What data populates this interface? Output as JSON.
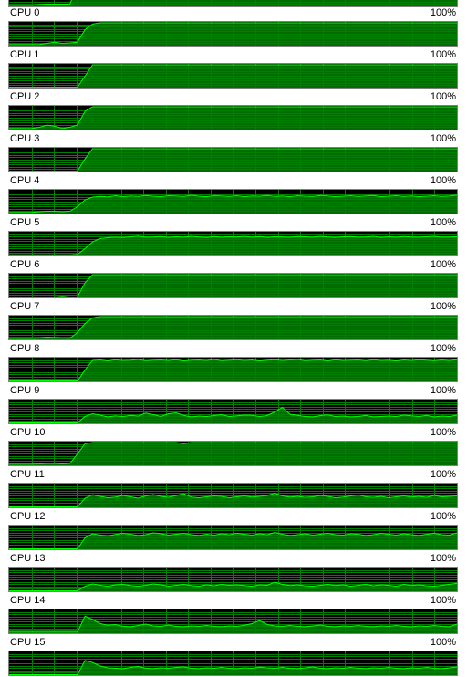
{
  "colors": {
    "graph_background": "#000000",
    "grid_line": "#008000",
    "usage_fill": "#008000",
    "usage_line": "#00ff00",
    "border": "#808080"
  },
  "cores": [
    {
      "label": "CPU 0",
      "max": "100%",
      "usage": [
        0.05,
        0.05,
        0.05,
        0.05,
        0.08,
        0.1,
        0.1,
        0.1,
        0.1,
        0.95,
        1,
        1,
        1,
        1,
        1,
        1,
        1,
        1,
        1,
        1,
        1,
        1,
        1,
        1,
        1,
        1,
        1,
        1,
        1,
        1,
        1,
        1,
        1,
        1,
        1,
        1,
        1,
        1,
        1,
        1,
        1,
        1,
        1,
        1,
        1,
        1,
        1,
        1,
        1,
        1,
        1,
        1,
        1,
        1,
        1,
        1,
        1,
        1,
        1,
        1
      ]
    },
    {
      "label": "CPU 1",
      "max": "100%",
      "usage": [
        0.05,
        0.05,
        0.05,
        0.05,
        0.05,
        0.1,
        0.15,
        0.1,
        0.12,
        0.15,
        0.7,
        0.95,
        1,
        1,
        1,
        1,
        1,
        1,
        1,
        1,
        1,
        1,
        1,
        1,
        1,
        1,
        1,
        1,
        1,
        1,
        1,
        1,
        1,
        1,
        1,
        1,
        1,
        1,
        1,
        1,
        1,
        1,
        1,
        1,
        1,
        1,
        1,
        1,
        1,
        1,
        1,
        1,
        1,
        1,
        1,
        1,
        1,
        1,
        1,
        1
      ]
    },
    {
      "label": "CPU 2",
      "max": "100%",
      "usage": [
        0.02,
        0.02,
        0.02,
        0.02,
        0.02,
        0.02,
        0.02,
        0.02,
        0.02,
        0.02,
        0.5,
        1,
        1,
        1,
        1,
        1,
        1,
        1,
        1,
        1,
        1,
        1,
        1,
        1,
        1,
        1,
        1,
        1,
        1,
        1,
        1,
        1,
        1,
        1,
        1,
        1,
        1,
        1,
        1,
        1,
        1,
        1,
        1,
        1,
        1,
        1,
        1,
        1,
        1,
        1,
        1,
        1,
        1,
        1,
        1,
        1,
        1,
        1,
        1,
        1
      ]
    },
    {
      "label": "CPU 3",
      "max": "100%",
      "usage": [
        0.05,
        0.05,
        0.05,
        0.05,
        0.1,
        0.2,
        0.15,
        0.05,
        0.1,
        0.2,
        0.8,
        1,
        1,
        1,
        1,
        1,
        1,
        1,
        1,
        1,
        1,
        1,
        1,
        1,
        1,
        1,
        1,
        1,
        1,
        1,
        1,
        1,
        1,
        1,
        1,
        1,
        1,
        1,
        1,
        1,
        1,
        1,
        1,
        1,
        1,
        1,
        1,
        1,
        1,
        1,
        1,
        1,
        1,
        1,
        1,
        1,
        1,
        1,
        1,
        1
      ]
    },
    {
      "label": "CPU 4",
      "max": "100%",
      "usage": [
        0.02,
        0.02,
        0.02,
        0.02,
        0.02,
        0.02,
        0.02,
        0.02,
        0.02,
        0.02,
        0.55,
        1,
        1,
        1,
        1,
        1,
        1,
        1,
        1,
        1,
        1,
        1,
        1,
        1,
        1,
        1,
        1,
        1,
        1,
        1,
        1,
        1,
        1,
        1,
        1,
        1,
        1,
        1,
        1,
        1,
        1,
        1,
        1,
        1,
        1,
        1,
        1,
        1,
        1,
        1,
        1,
        1,
        1,
        1,
        1,
        1,
        1,
        1,
        1,
        1
      ]
    },
    {
      "label": "CPU 5",
      "max": "100%",
      "usage": [
        0.05,
        0.05,
        0.05,
        0.05,
        0.08,
        0.1,
        0.1,
        0.08,
        0.1,
        0.3,
        0.6,
        0.72,
        0.75,
        0.73,
        0.78,
        0.74,
        0.77,
        0.75,
        0.79,
        0.76,
        0.74,
        0.78,
        0.77,
        0.75,
        0.8,
        0.76,
        0.74,
        0.78,
        0.77,
        0.75,
        0.78,
        0.74,
        0.77,
        0.76,
        0.79,
        0.75,
        0.77,
        0.74,
        0.78,
        0.76,
        0.75,
        0.79,
        0.77,
        0.74,
        0.76,
        0.78,
        0.75,
        0.77,
        0.79,
        0.74,
        0.76,
        0.78,
        0.75,
        0.77,
        0.74,
        0.76,
        0.78,
        0.75,
        0.77,
        0.8
      ]
    },
    {
      "label": "CPU 6",
      "max": "100%",
      "usage": [
        0.03,
        0.03,
        0.03,
        0.03,
        0.03,
        0.03,
        0.03,
        0.03,
        0.03,
        0.05,
        0.3,
        0.6,
        0.75,
        0.78,
        0.8,
        0.79,
        0.82,
        0.85,
        0.8,
        0.81,
        0.83,
        0.79,
        0.82,
        0.8,
        0.84,
        0.81,
        0.79,
        0.83,
        0.8,
        0.82,
        0.81,
        0.84,
        0.8,
        0.83,
        0.79,
        0.82,
        0.81,
        0.8,
        0.83,
        0.82,
        0.8,
        0.84,
        0.81,
        0.79,
        0.82,
        0.83,
        0.8,
        0.81,
        0.84,
        0.79,
        0.82,
        0.8,
        0.83,
        0.81,
        0.8,
        0.82,
        0.84,
        0.8,
        0.81,
        0.82
      ]
    },
    {
      "label": "CPU 7",
      "max": "100%",
      "usage": [
        0.02,
        0.02,
        0.02,
        0.02,
        0.02,
        0.02,
        0.02,
        0.05,
        0.02,
        0.02,
        0.65,
        1,
        1,
        1,
        1,
        1,
        1,
        1,
        1,
        1,
        1,
        1,
        1,
        1,
        1,
        1,
        1,
        1,
        1,
        1,
        1,
        1,
        1,
        1,
        1,
        1,
        1,
        1,
        1,
        1,
        1,
        1,
        1,
        1,
        1,
        1,
        1,
        1,
        1,
        1,
        1,
        1,
        1,
        1,
        1,
        1,
        1,
        1,
        1,
        1
      ]
    },
    {
      "label": "CPU 8",
      "max": "100%",
      "usage": [
        0.05,
        0.05,
        0.05,
        0.05,
        0.06,
        0.1,
        0.08,
        0.06,
        0.05,
        0.3,
        0.7,
        0.95,
        1,
        1,
        1,
        1,
        1,
        1,
        1,
        1,
        1,
        1,
        1,
        1,
        1,
        1,
        1,
        1,
        1,
        1,
        1,
        1,
        1,
        1,
        1,
        1,
        1,
        1,
        1,
        1,
        1,
        1,
        1,
        1,
        1,
        1,
        1,
        1,
        1,
        1,
        1,
        1,
        1,
        1,
        1,
        1,
        1,
        1,
        1,
        1
      ]
    },
    {
      "label": "CPU 9",
      "max": "100%",
      "usage": [
        0.02,
        0.02,
        0.02,
        0.02,
        0.02,
        0.02,
        0.02,
        0.02,
        0.02,
        0.02,
        0.5,
        0.92,
        0.94,
        0.9,
        0.95,
        0.92,
        0.93,
        0.96,
        0.91,
        0.93,
        0.94,
        0.92,
        0.95,
        0.9,
        0.93,
        0.94,
        0.92,
        0.96,
        0.91,
        0.93,
        0.95,
        0.92,
        0.94,
        0.9,
        0.93,
        0.95,
        0.92,
        0.94,
        0.96,
        0.91,
        0.93,
        0.94,
        0.9,
        0.95,
        0.92,
        0.93,
        0.94,
        0.91,
        0.95,
        0.92,
        0.93,
        0.9,
        0.94,
        0.92,
        0.95,
        0.93,
        0.91,
        0.94,
        0.92,
        0.95
      ]
    },
    {
      "label": "CPU 10",
      "max": "100%",
      "usage": [
        0.02,
        0.02,
        0.02,
        0.02,
        0.02,
        0.02,
        0.02,
        0.02,
        0.02,
        0.02,
        0.3,
        0.42,
        0.36,
        0.28,
        0.33,
        0.3,
        0.35,
        0.32,
        0.45,
        0.38,
        0.3,
        0.42,
        0.46,
        0.35,
        0.28,
        0.32,
        0.3,
        0.34,
        0.38,
        0.3,
        0.33,
        0.36,
        0.35,
        0.3,
        0.34,
        0.5,
        0.7,
        0.4,
        0.35,
        0.3,
        0.28,
        0.34,
        0.37,
        0.3,
        0.32,
        0.28,
        0.3,
        0.35,
        0.28,
        0.3,
        0.32,
        0.3,
        0.36,
        0.33,
        0.3,
        0.35,
        0.28,
        0.32,
        0.3,
        0.36
      ]
    },
    {
      "label": "CPU 11",
      "max": "100%",
      "usage": [
        0.05,
        0.05,
        0.05,
        0.05,
        0.06,
        0.08,
        0.08,
        0.06,
        0.08,
        0.5,
        0.95,
        1,
        1,
        1,
        1,
        1,
        1,
        1,
        1,
        1,
        1,
        1,
        1,
        0.95,
        1,
        1,
        1,
        1,
        1,
        1,
        1,
        1,
        1,
        1,
        1,
        1,
        1,
        1,
        1,
        1,
        1,
        1,
        1,
        1,
        1,
        1,
        1,
        1,
        1,
        1,
        1,
        1,
        1,
        1,
        1,
        1,
        1,
        1,
        1,
        1
      ]
    },
    {
      "label": "CPU 12",
      "max": "100%",
      "usage": [
        0.02,
        0.02,
        0.02,
        0.02,
        0.02,
        0.02,
        0.02,
        0.02,
        0.02,
        0.02,
        0.4,
        0.55,
        0.48,
        0.42,
        0.45,
        0.52,
        0.46,
        0.4,
        0.5,
        0.56,
        0.48,
        0.44,
        0.52,
        0.6,
        0.45,
        0.42,
        0.46,
        0.5,
        0.48,
        0.42,
        0.46,
        0.5,
        0.45,
        0.48,
        0.52,
        0.62,
        0.5,
        0.45,
        0.48,
        0.44,
        0.46,
        0.52,
        0.48,
        0.42,
        0.45,
        0.5,
        0.55,
        0.46,
        0.44,
        0.48,
        0.42,
        0.46,
        0.5,
        0.45,
        0.48,
        0.44,
        0.52,
        0.46,
        0.48,
        0.5
      ]
    },
    {
      "label": "CPU 13",
      "max": "100%",
      "usage": [
        0.02,
        0.02,
        0.02,
        0.02,
        0.02,
        0.02,
        0.02,
        0.02,
        0.02,
        0.02,
        0.5,
        0.68,
        0.62,
        0.58,
        0.65,
        0.7,
        0.66,
        0.6,
        0.64,
        0.72,
        0.68,
        0.62,
        0.66,
        0.7,
        0.64,
        0.6,
        0.66,
        0.62,
        0.68,
        0.64,
        0.7,
        0.66,
        0.62,
        0.68,
        0.64,
        0.74,
        0.66,
        0.6,
        0.64,
        0.68,
        0.62,
        0.66,
        0.7,
        0.64,
        0.62,
        0.68,
        0.66,
        0.6,
        0.64,
        0.7,
        0.66,
        0.62,
        0.68,
        0.64,
        0.6,
        0.66,
        0.7,
        0.64,
        0.62,
        0.72
      ]
    },
    {
      "label": "CPU 14",
      "max": "100%",
      "usage": [
        0.02,
        0.02,
        0.02,
        0.02,
        0.02,
        0.02,
        0.02,
        0.02,
        0.02,
        0.02,
        0.22,
        0.32,
        0.26,
        0.22,
        0.28,
        0.3,
        0.25,
        0.22,
        0.26,
        0.32,
        0.28,
        0.22,
        0.26,
        0.3,
        0.25,
        0.22,
        0.28,
        0.24,
        0.3,
        0.26,
        0.28,
        0.25,
        0.22,
        0.28,
        0.26,
        0.4,
        0.3,
        0.25,
        0.28,
        0.24,
        0.22,
        0.26,
        0.3,
        0.25,
        0.28,
        0.22,
        0.26,
        0.3,
        0.24,
        0.28,
        0.26,
        0.22,
        0.3,
        0.25,
        0.28,
        0.24,
        0.22,
        0.26,
        0.3,
        0.35
      ]
    },
    {
      "label": "CPU 15",
      "max": "100%",
      "usage": [
        0.05,
        0.05,
        0.05,
        0.05,
        0.05,
        0.05,
        0.05,
        0.05,
        0.05,
        0.05,
        0.75,
        0.6,
        0.42,
        0.35,
        0.38,
        0.3,
        0.28,
        0.34,
        0.4,
        0.32,
        0.3,
        0.36,
        0.3,
        0.28,
        0.32,
        0.3,
        0.34,
        0.3,
        0.28,
        0.32,
        0.3,
        0.35,
        0.42,
        0.55,
        0.38,
        0.32,
        0.3,
        0.34,
        0.3,
        0.28,
        0.32,
        0.36,
        0.3,
        0.28,
        0.32,
        0.3,
        0.34,
        0.3,
        0.28,
        0.32,
        0.3,
        0.34,
        0.3,
        0.28,
        0.32,
        0.3,
        0.34,
        0.3,
        0.28,
        0.4
      ]
    },
    {
      "label": "",
      "max": "",
      "usage": [
        0.02,
        0.02,
        0.02,
        0.02,
        0.02,
        0.02,
        0.02,
        0.02,
        0.02,
        0.02,
        0.65,
        0.55,
        0.4,
        0.32,
        0.3,
        0.28,
        0.34,
        0.38,
        0.3,
        0.28,
        0.32,
        0.3,
        0.34,
        0.36,
        0.3,
        0.28,
        0.32,
        0.3,
        0.34,
        0.3,
        0.28,
        0.32,
        0.3,
        0.35,
        0.32,
        0.3,
        0.34,
        0.3,
        0.28,
        0.32,
        0.36,
        0.3,
        0.28,
        0.32,
        0.3,
        0.34,
        0.3,
        0.28,
        0.32,
        0.3,
        0.34,
        0.3,
        0.28,
        0.32,
        0.3,
        0.34,
        0.3,
        0.28,
        0.32,
        0.36
      ]
    }
  ]
}
